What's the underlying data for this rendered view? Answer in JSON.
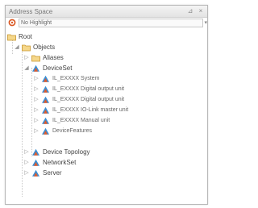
{
  "panel": {
    "title": "Address Space",
    "toolbar_selector": "No Highlight"
  },
  "tree": {
    "root": "Root",
    "objects": "Objects",
    "aliases": "Aliases",
    "device_set": "DeviceSet",
    "device_children": [
      "IL_EXXXX System",
      "IL_EXXXX Digital output unit",
      "IL_EXXXX Digital output unit",
      "IL_EXXXX IO-Link master unit",
      "IL_EXXXX Manual unit"
    ],
    "device_features": "DeviceFeatures",
    "device_topology": "Device Topology",
    "network_set": "NetworkSet",
    "server": "Server"
  },
  "colors": {
    "folder": "#e8b84a",
    "device": "#3b8fd4",
    "device_accent": "#e05a2b",
    "accent": "#d9541e"
  }
}
